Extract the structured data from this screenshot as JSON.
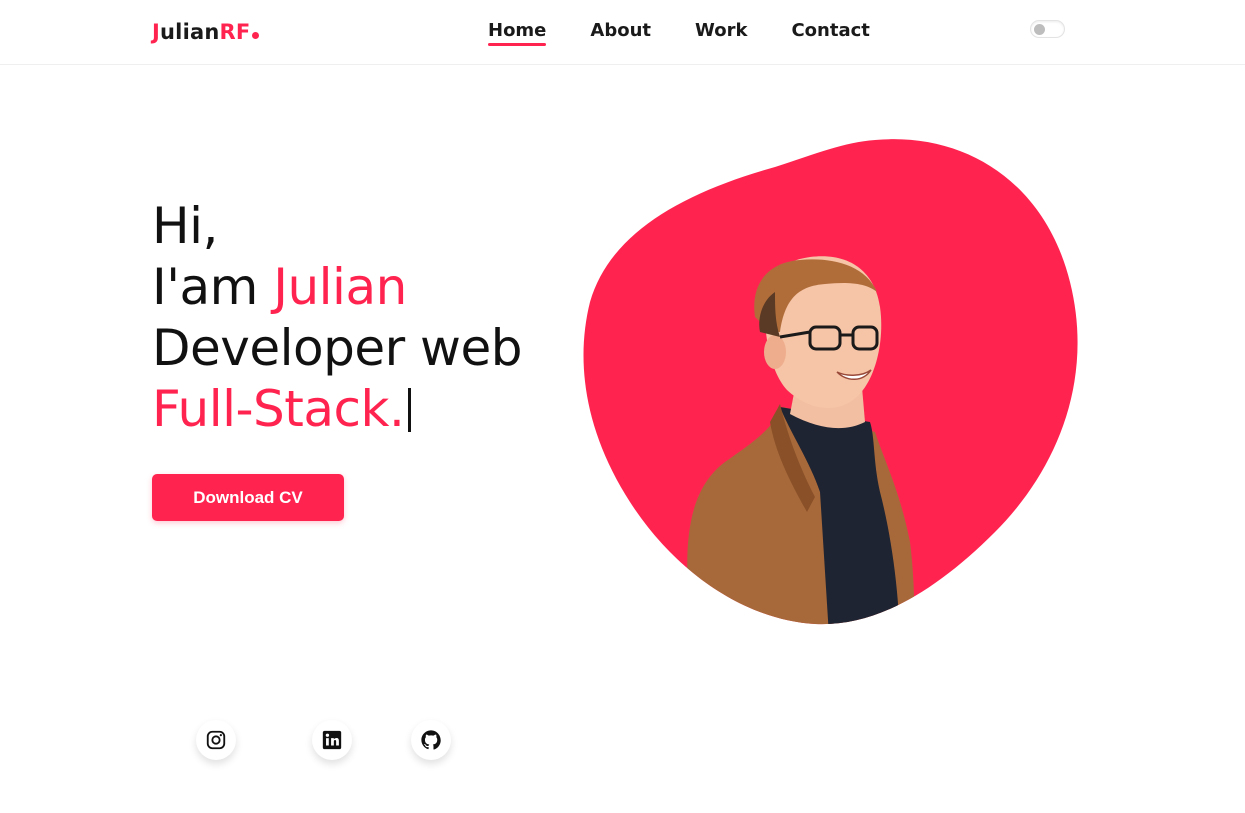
{
  "header": {
    "logo": {
      "part1": "Julian",
      "part2": "RF"
    },
    "nav": [
      {
        "label": "Home",
        "active": true
      },
      {
        "label": "About",
        "active": false
      },
      {
        "label": "Work",
        "active": false
      },
      {
        "label": "Contact",
        "active": false
      }
    ],
    "theme_toggle": {
      "state": "off"
    }
  },
  "hero": {
    "line1": "Hi,",
    "line2_prefix": "I'am ",
    "line2_name": "Julian",
    "line3": "Developer web",
    "line4": "Full-Stack.",
    "cta_label": "Download CV"
  },
  "social": [
    {
      "name": "instagram-icon"
    },
    {
      "name": "linkedin-icon"
    },
    {
      "name": "github-icon"
    }
  ],
  "colors": {
    "accent": "#ff2450",
    "text": "#111111",
    "jacket": "#a8693a",
    "shirt": "#1f2433"
  }
}
